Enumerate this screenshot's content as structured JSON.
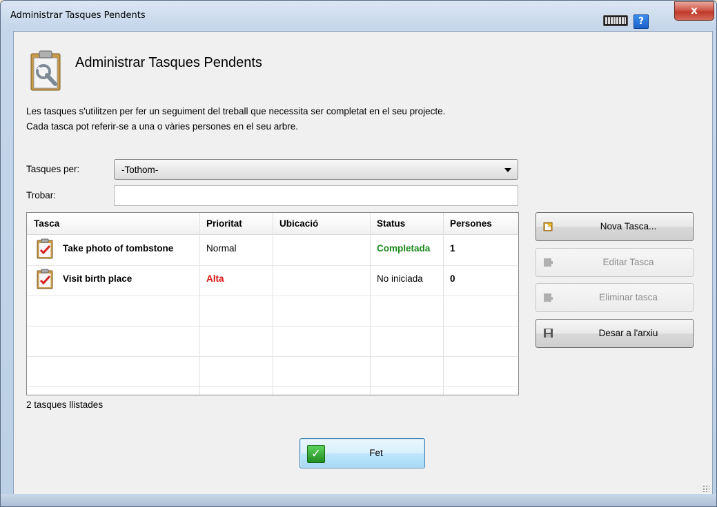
{
  "window": {
    "title": "Administrar Tasques Pendents",
    "close_glyph": "x",
    "help_glyph": "?"
  },
  "header": {
    "title": "Administrar Tasques Pendents",
    "icon": "clipboard-wrench-icon"
  },
  "description": {
    "line1": "Les tasques s'utilitzen per fer un seguiment del treball que necessita ser completat en el seu projecte.",
    "line2": "Cada tasca pot referir-se a una o vàries persones en el seu arbre."
  },
  "filter": {
    "label": "Tasques per:",
    "selected": "-Tothom-"
  },
  "search": {
    "label": "Trobar:",
    "value": "",
    "placeholder": ""
  },
  "table": {
    "columns": [
      "Tasca",
      "Prioritat",
      "Ubicació",
      "Status",
      "Persones"
    ],
    "rows": [
      {
        "task": "Take photo of tombstone",
        "priority": "Normal",
        "location": "",
        "status": "Completada",
        "persons": "1"
      },
      {
        "task": "Visit birth place",
        "priority": "Alta",
        "location": "",
        "status": "No iniciada",
        "persons": "0"
      }
    ]
  },
  "actions": {
    "new_task": "Nova Tasca...",
    "edit_task": "Editar Tasca",
    "delete_task": "Eliminar tasca",
    "save_file": "Desar a l'arxiu"
  },
  "footer": {
    "count_text": "2 tasques llistades",
    "done_label": "Fet",
    "done_check": "✓"
  },
  "colors": {
    "completed": "#1a8a1a",
    "high_priority": "#e01010"
  }
}
